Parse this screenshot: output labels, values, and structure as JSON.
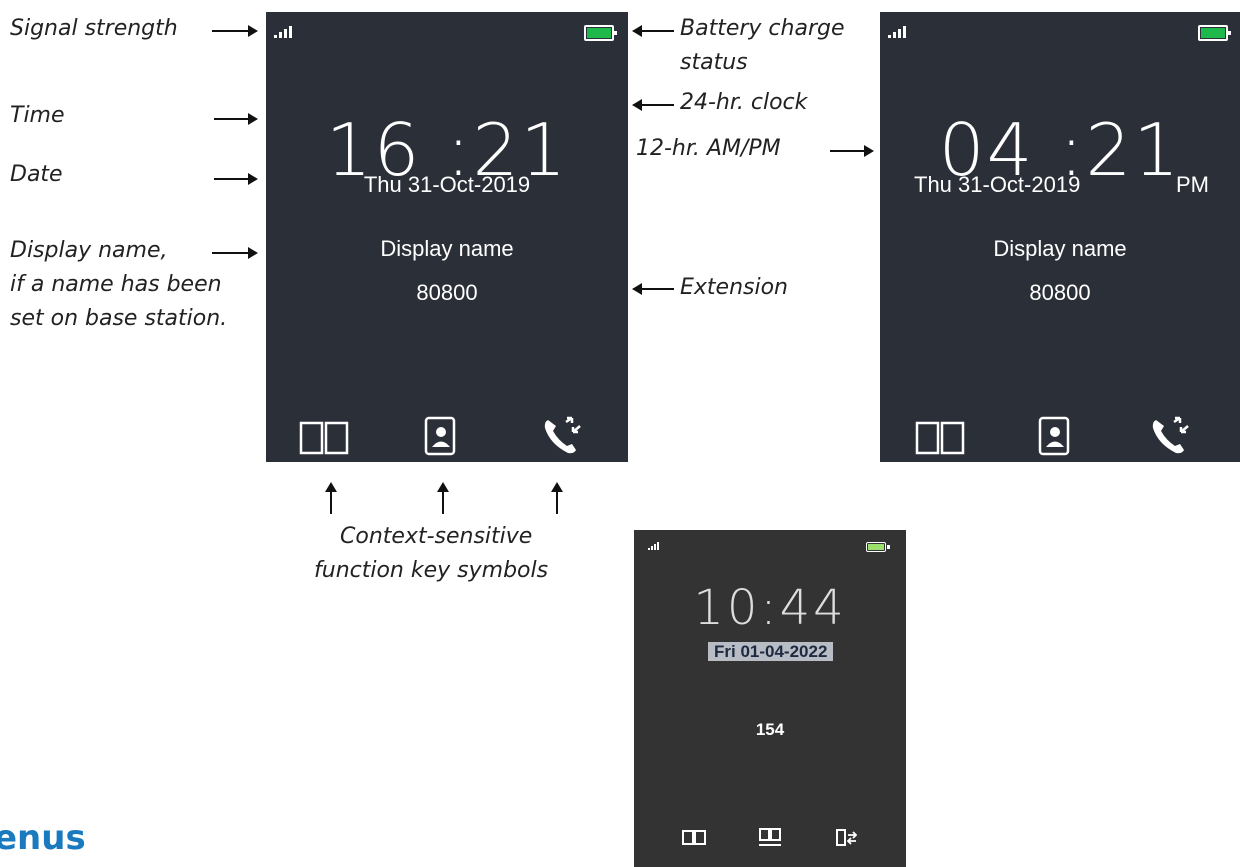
{
  "labels_left": {
    "signal": "Signal strength",
    "time": "Time",
    "date": "Date",
    "display_name_1": "Display name,",
    "display_name_2": "if a name has been",
    "display_name_3": "set on base station."
  },
  "labels_mid": {
    "battery_1": "Battery charge",
    "battery_2": "status",
    "clock24": "24-hr. clock",
    "clock12": "12-hr. AM/PM",
    "extension": "Extension"
  },
  "labels_bottom": {
    "function_keys_1": "Context-sensitive",
    "function_keys_2": "function key symbols"
  },
  "phone1": {
    "time": "16 :21",
    "date": "Thu 31-Oct-2019",
    "display_name": "Display name",
    "extension": "80800"
  },
  "phone2": {
    "time": "04 :21",
    "date": "Thu 31-Oct-2019",
    "ampm": "PM",
    "display_name": "Display name",
    "extension": "80800"
  },
  "phone3": {
    "time": "10:44",
    "date": "Fri 01-04-2022",
    "extension": "154"
  },
  "section_heading": "enus",
  "colors": {
    "screen": "#2b2f38",
    "screen_dark": "#333333",
    "battery": "#1fb84a",
    "heading": "#1a7ac0"
  },
  "icons": [
    "signal-icon",
    "battery-icon",
    "phonebook-icon",
    "contact-card-icon",
    "call-transfer-icon"
  ]
}
